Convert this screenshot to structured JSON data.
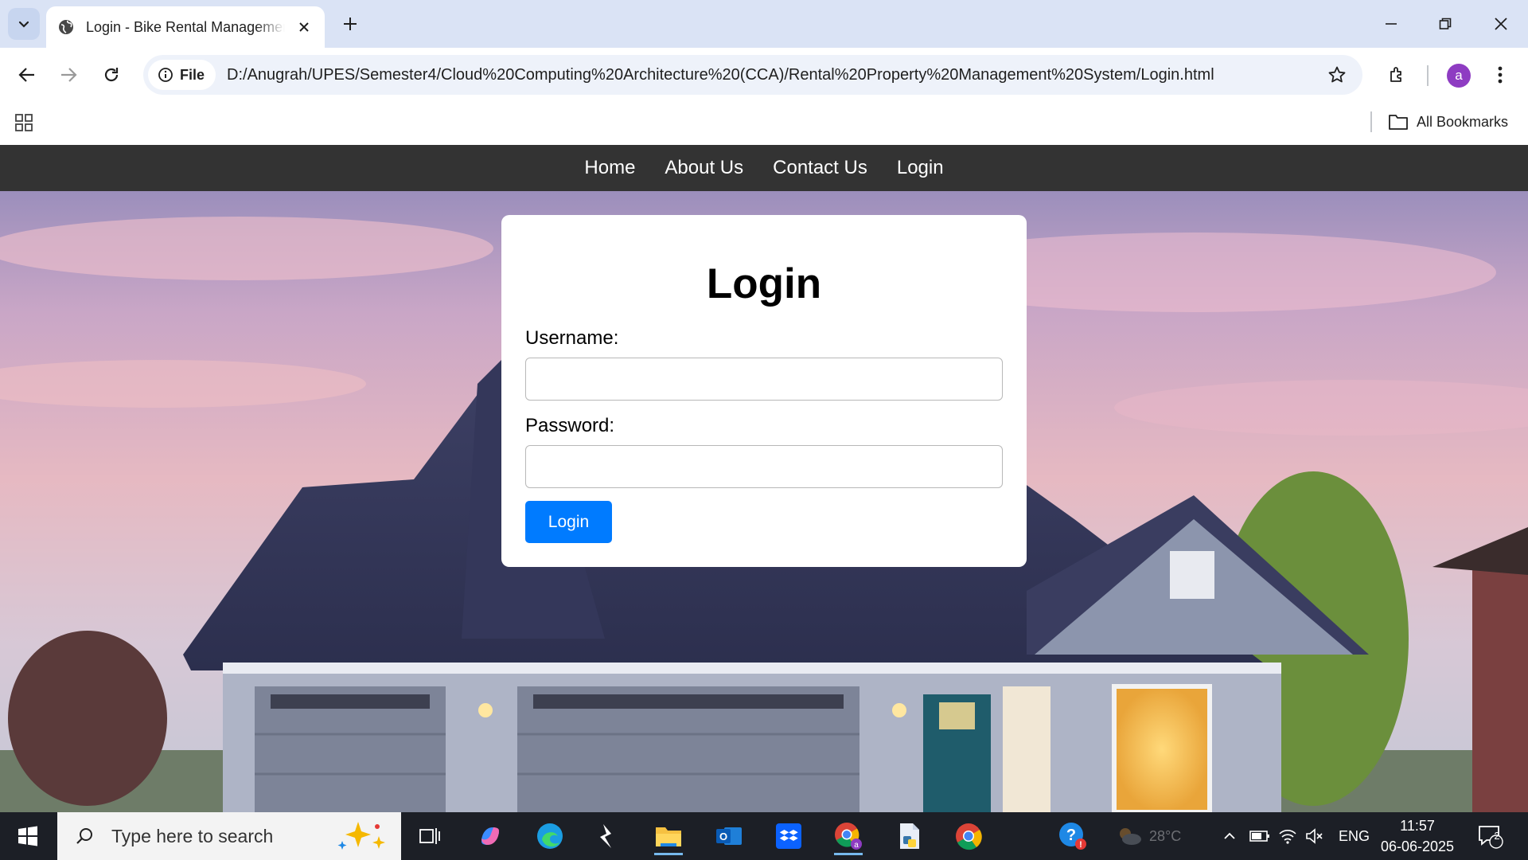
{
  "browser": {
    "tab_title": "Login - Bike Rental Management System",
    "url_scheme_label": "File",
    "url": "D:/Anugrah/UPES/Semester4/Cloud%20Computing%20Architecture%20(CCA)/Rental%20Property%20Management%20System/Login.html",
    "profile_initial": "a",
    "bookmarks_label": "All Bookmarks"
  },
  "site_nav": {
    "items": [
      {
        "label": "Home"
      },
      {
        "label": "About Us"
      },
      {
        "label": "Contact Us"
      },
      {
        "label": "Login"
      }
    ]
  },
  "login_form": {
    "title": "Login",
    "username_label": "Username:",
    "username_value": "",
    "password_label": "Password:",
    "password_value": "",
    "submit_label": "Login"
  },
  "taskbar": {
    "search_placeholder": "Type here to search",
    "weather": "28°C",
    "language": "ENG",
    "time": "11:57",
    "date": "06-06-2025",
    "notification_count": "2"
  },
  "colors": {
    "nav_bg": "#333333",
    "primary_button": "#007bff",
    "tabbar_bg": "#dae3f5",
    "taskbar_bg": "#1c1f26"
  }
}
